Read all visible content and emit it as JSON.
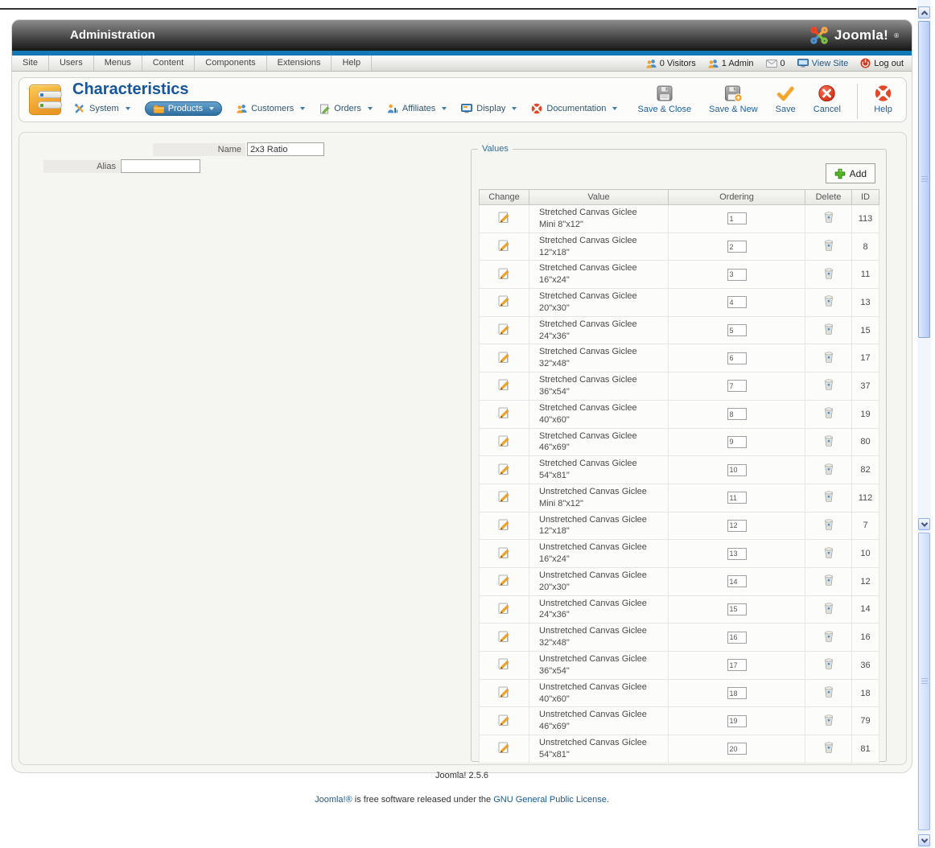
{
  "window": {
    "title": "Administration",
    "logo_text": "Joomla!",
    "logo_mark": "®"
  },
  "colors": {
    "accent_blue": "#1278b6",
    "title_blue": "#15569c",
    "link_blue": "#1b5a93",
    "active_pill": "#2e6e9e",
    "add_green": "#53b824",
    "cancel_red": "#e03c22",
    "save_orange": "#f5a623"
  },
  "menubar": {
    "items": [
      "Site",
      "Users",
      "Menus",
      "Content",
      "Components",
      "Extensions",
      "Help"
    ],
    "status": {
      "visitors": "0 Visitors",
      "admins": "1 Admin",
      "messages": "0",
      "view_site": "View Site",
      "logout": "Log out"
    }
  },
  "page": {
    "title": "Characteristics",
    "component_menu": [
      {
        "label": "System",
        "icon": "system-tools-icon"
      },
      {
        "label": "Products",
        "icon": "products-folder-icon",
        "active": true
      },
      {
        "label": "Customers",
        "icon": "customers-person-icon"
      },
      {
        "label": "Orders",
        "icon": "orders-page-icon"
      },
      {
        "label": "Affiliates",
        "icon": "affiliates-chart-icon"
      },
      {
        "label": "Display",
        "icon": "display-monitor-icon"
      },
      {
        "label": "Documentation",
        "icon": "documentation-ring-icon"
      }
    ],
    "toolbar_buttons": [
      {
        "label": "Save & Close",
        "icon": "save-close-floppy-icon"
      },
      {
        "label": "Save & New",
        "icon": "save-new-floppy-plus-icon"
      },
      {
        "label": "Save",
        "icon": "save-check-icon"
      },
      {
        "label": "Cancel",
        "icon": "cancel-x-icon"
      },
      {
        "label": "Help",
        "icon": "help-lifering-icon"
      }
    ]
  },
  "form": {
    "name_label": "Name",
    "name_value": "2x3 Ratio",
    "alias_label": "Alias",
    "alias_value": ""
  },
  "values_panel": {
    "legend": "Values",
    "add_label": "Add",
    "table": {
      "headers": [
        "Change",
        "Value",
        "Ordering",
        "Delete",
        "ID"
      ],
      "rows": [
        {
          "value": "Stretched Canvas Giclee Mini 8\"x12\"",
          "ordering": "1",
          "id": "113"
        },
        {
          "value": "Stretched Canvas Giclee 12\"x18\"",
          "ordering": "2",
          "id": "8"
        },
        {
          "value": "Stretched Canvas Giclee 16\"x24\"",
          "ordering": "3",
          "id": "11"
        },
        {
          "value": "Stretched Canvas Giclee 20\"x30\"",
          "ordering": "4",
          "id": "13"
        },
        {
          "value": "Stretched Canvas Giclee 24\"x36\"",
          "ordering": "5",
          "id": "15"
        },
        {
          "value": "Stretched Canvas Giclee 32\"x48\"",
          "ordering": "6",
          "id": "17"
        },
        {
          "value": "Stretched Canvas Giclee 36\"x54\"",
          "ordering": "7",
          "id": "37"
        },
        {
          "value": "Stretched Canvas Giclee 40\"x60\"",
          "ordering": "8",
          "id": "19"
        },
        {
          "value": "Stretched Canvas Giclee 46\"x69\"",
          "ordering": "9",
          "id": "80"
        },
        {
          "value": "Stretched Canvas Giclee 54\"x81\"",
          "ordering": "10",
          "id": "82"
        },
        {
          "value": "Unstretched Canvas Giclee Mini 8\"x12\"",
          "ordering": "11",
          "id": "112"
        },
        {
          "value": "Unstretched Canvas Giclee 12\"x18\"",
          "ordering": "12",
          "id": "7"
        },
        {
          "value": "Unstretched Canvas Giclee 16\"x24\"",
          "ordering": "13",
          "id": "10"
        },
        {
          "value": "Unstretched Canvas Giclee 20\"x30\"",
          "ordering": "14",
          "id": "12"
        },
        {
          "value": "Unstretched Canvas Giclee 24\"x36\"",
          "ordering": "15",
          "id": "14"
        },
        {
          "value": "Unstretched Canvas Giclee 32\"x48\"",
          "ordering": "16",
          "id": "16"
        },
        {
          "value": "Unstretched Canvas Giclee 36\"x54\"",
          "ordering": "17",
          "id": "36"
        },
        {
          "value": "Unstretched Canvas Giclee 40\"x60\"",
          "ordering": "18",
          "id": "18"
        },
        {
          "value": "Unstretched Canvas Giclee 46\"x69\"",
          "ordering": "19",
          "id": "79"
        },
        {
          "value": "Unstretched Canvas Giclee 54\"x81\"",
          "ordering": "20",
          "id": "81"
        }
      ]
    }
  },
  "footer": {
    "version": "Joomla! 2.5.6",
    "license": {
      "link_joomla": "Joomla!®",
      "middle": " is free software released under the ",
      "link_gpl": "GNU General Public License",
      "period": "."
    }
  }
}
